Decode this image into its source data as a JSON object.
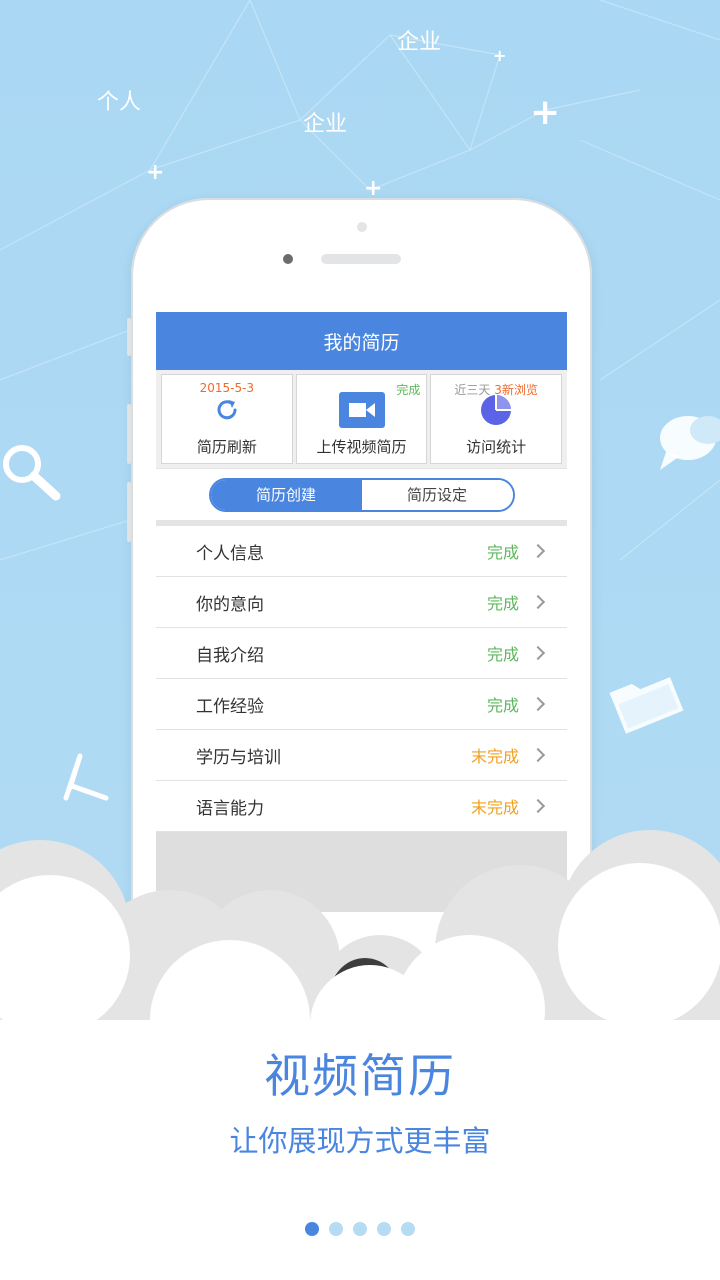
{
  "background": {
    "floating_words": [
      "企业",
      "个人",
      "企业"
    ]
  },
  "screen": {
    "header_title": "我的简历",
    "stats": [
      {
        "top_text": "2015-5-3",
        "top_color": "#f06a2c",
        "label": "简历刷新",
        "icon": "refresh-icon"
      },
      {
        "top_text": "完成",
        "top_color": "#5cb85c",
        "label": "上传视频简历",
        "icon": "video-camera-icon"
      },
      {
        "top_text_a": "近三天",
        "top_text_b": "3新浏览",
        "top_color_a": "#999999",
        "top_color_b": "#f06a2c",
        "label": "访问统计",
        "icon": "pie-chart-icon"
      }
    ],
    "segments": [
      "简历创建",
      "简历设定"
    ],
    "rows": [
      {
        "label": "个人信息",
        "status": "完成",
        "color": "#5cb85c"
      },
      {
        "label": "你的意向",
        "status": "完成",
        "color": "#5cb85c"
      },
      {
        "label": "自我介绍",
        "status": "完成",
        "color": "#5cb85c"
      },
      {
        "label": "工作经验",
        "status": "完成",
        "color": "#5cb85c"
      },
      {
        "label": "学历与培训",
        "status": "末完成",
        "color": "#f0a020"
      },
      {
        "label": "语言能力",
        "status": "末完成",
        "color": "#f0a020"
      }
    ]
  },
  "headline": "视频简历",
  "subline": "让你展现方式更丰富",
  "pager": {
    "count": 5,
    "active_index": 0
  },
  "colors": {
    "accent": "#4a86e0",
    "sky": "#aad7f3"
  }
}
